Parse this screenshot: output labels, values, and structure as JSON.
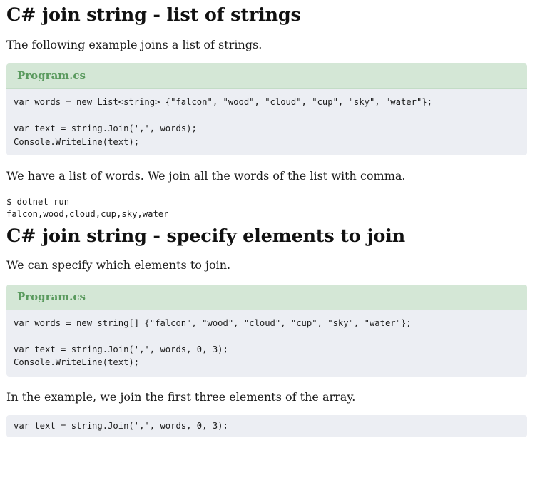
{
  "sections": [
    {
      "heading": "C# join string - list of strings",
      "intro": "The following example joins a list of strings.",
      "code_title": "Program.cs",
      "code": "var words = new List<string> {\"falcon\", \"wood\", \"cloud\", \"cup\", \"sky\", \"water\"};\n\nvar text = string.Join(',', words);\nConsole.WriteLine(text);",
      "explanation": "We have a list of words. We join all the words of the list with comma.",
      "output": "$ dotnet run\nfalcon,wood,cloud,cup,sky,water"
    },
    {
      "heading": "C# join string - specify elements to join",
      "intro": "We can specify which elements to join.",
      "code_title": "Program.cs",
      "code": "var words = new string[] {\"falcon\", \"wood\", \"cloud\", \"cup\", \"sky\", \"water\"};\n\nvar text = string.Join(',', words, 0, 3);\nConsole.WriteLine(text);",
      "explanation": "In the example, we join the first three elements of the array.",
      "snippet": "var text = string.Join(',', words, 0, 3);"
    }
  ]
}
